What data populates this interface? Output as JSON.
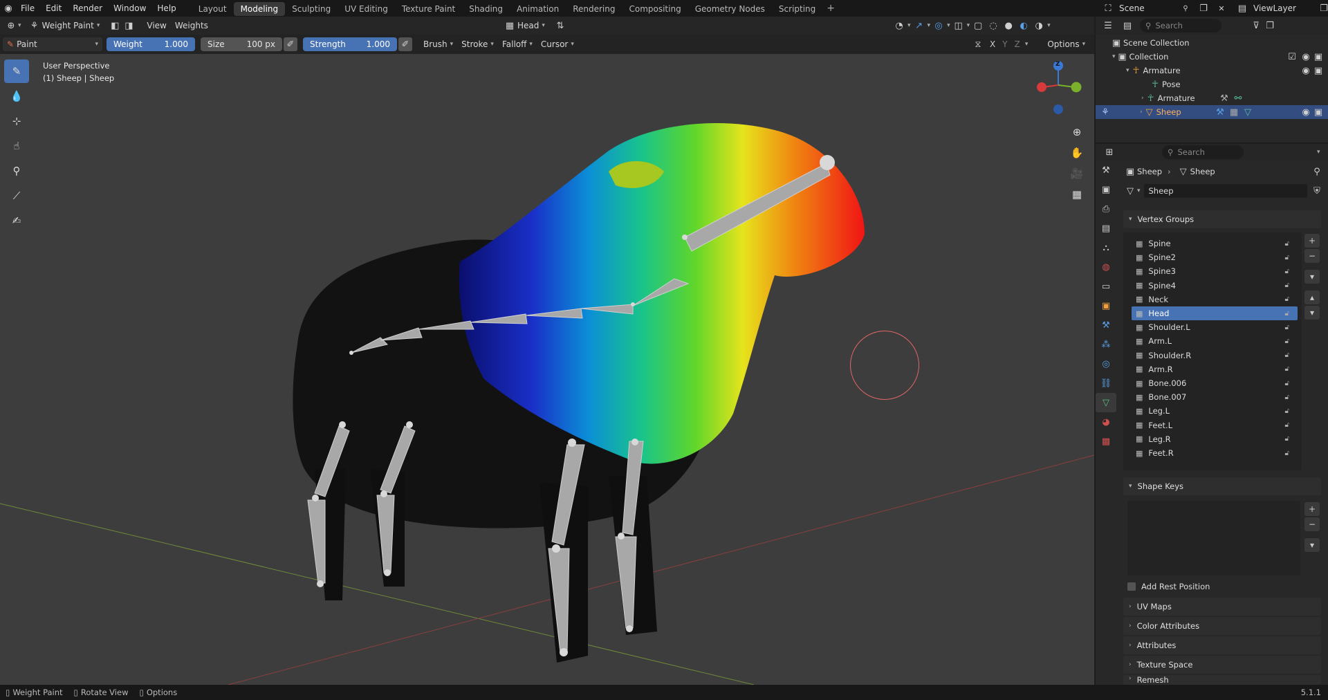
{
  "topbar": {
    "menus": [
      "File",
      "Edit",
      "Render",
      "Window",
      "Help"
    ],
    "workspaces": [
      "Layout",
      "Modeling",
      "Sculpting",
      "UV Editing",
      "Texture Paint",
      "Shading",
      "Animation",
      "Rendering",
      "Compositing",
      "Geometry Nodes",
      "Scripting"
    ],
    "active_workspace": "Modeling",
    "scene": "Scene",
    "viewlayer": "ViewLayer"
  },
  "header": {
    "mode": "Weight Paint",
    "view": "View",
    "weights": "Weights",
    "bone": "Head",
    "brush_name": "Paint",
    "weight_label": "Weight",
    "weight_value": "1.000",
    "size_label": "Size",
    "size_value": "100 px",
    "strength_label": "Strength",
    "strength_value": "1.000",
    "brush": "Brush",
    "stroke": "Stroke",
    "falloff": "Falloff",
    "cursor": "Cursor",
    "mirror_x": "X",
    "mirror_y": "Y",
    "mirror_z": "Z",
    "options": "Options"
  },
  "viewport": {
    "perspective": "User Perspective",
    "object_info": "(1) Sheep | Sheep",
    "gizmo_z": "Z"
  },
  "outliner": {
    "search_placeholder": "Search",
    "scene_collection": "Scene Collection",
    "collection": "Collection",
    "armature": "Armature",
    "pose": "Pose",
    "armature_data": "Armature",
    "sheep": "Sheep"
  },
  "properties": {
    "search_placeholder": "Search",
    "breadcrumb_object": "Sheep",
    "breadcrumb_mesh": "Sheep",
    "mesh_name": "Sheep",
    "vertex_groups_title": "Vertex Groups",
    "vertex_groups": [
      "Spine",
      "Spine2",
      "Spine3",
      "Spine4",
      "Neck",
      "Head",
      "Shoulder.L",
      "Arm.L",
      "Shoulder.R",
      "Arm.R",
      "Bone.006",
      "Bone.007",
      "Leg.L",
      "Feet.L",
      "Leg.R",
      "Feet.R"
    ],
    "active_group": "Head",
    "shape_keys_title": "Shape Keys",
    "add_rest_position": "Add Rest Position",
    "panels": [
      "UV Maps",
      "Color Attributes",
      "Attributes",
      "Texture Space",
      "Remesh"
    ]
  },
  "statusbar": {
    "item1": "Weight Paint",
    "item2": "Rotate View",
    "item3": "Options",
    "version": "5.1.1"
  }
}
